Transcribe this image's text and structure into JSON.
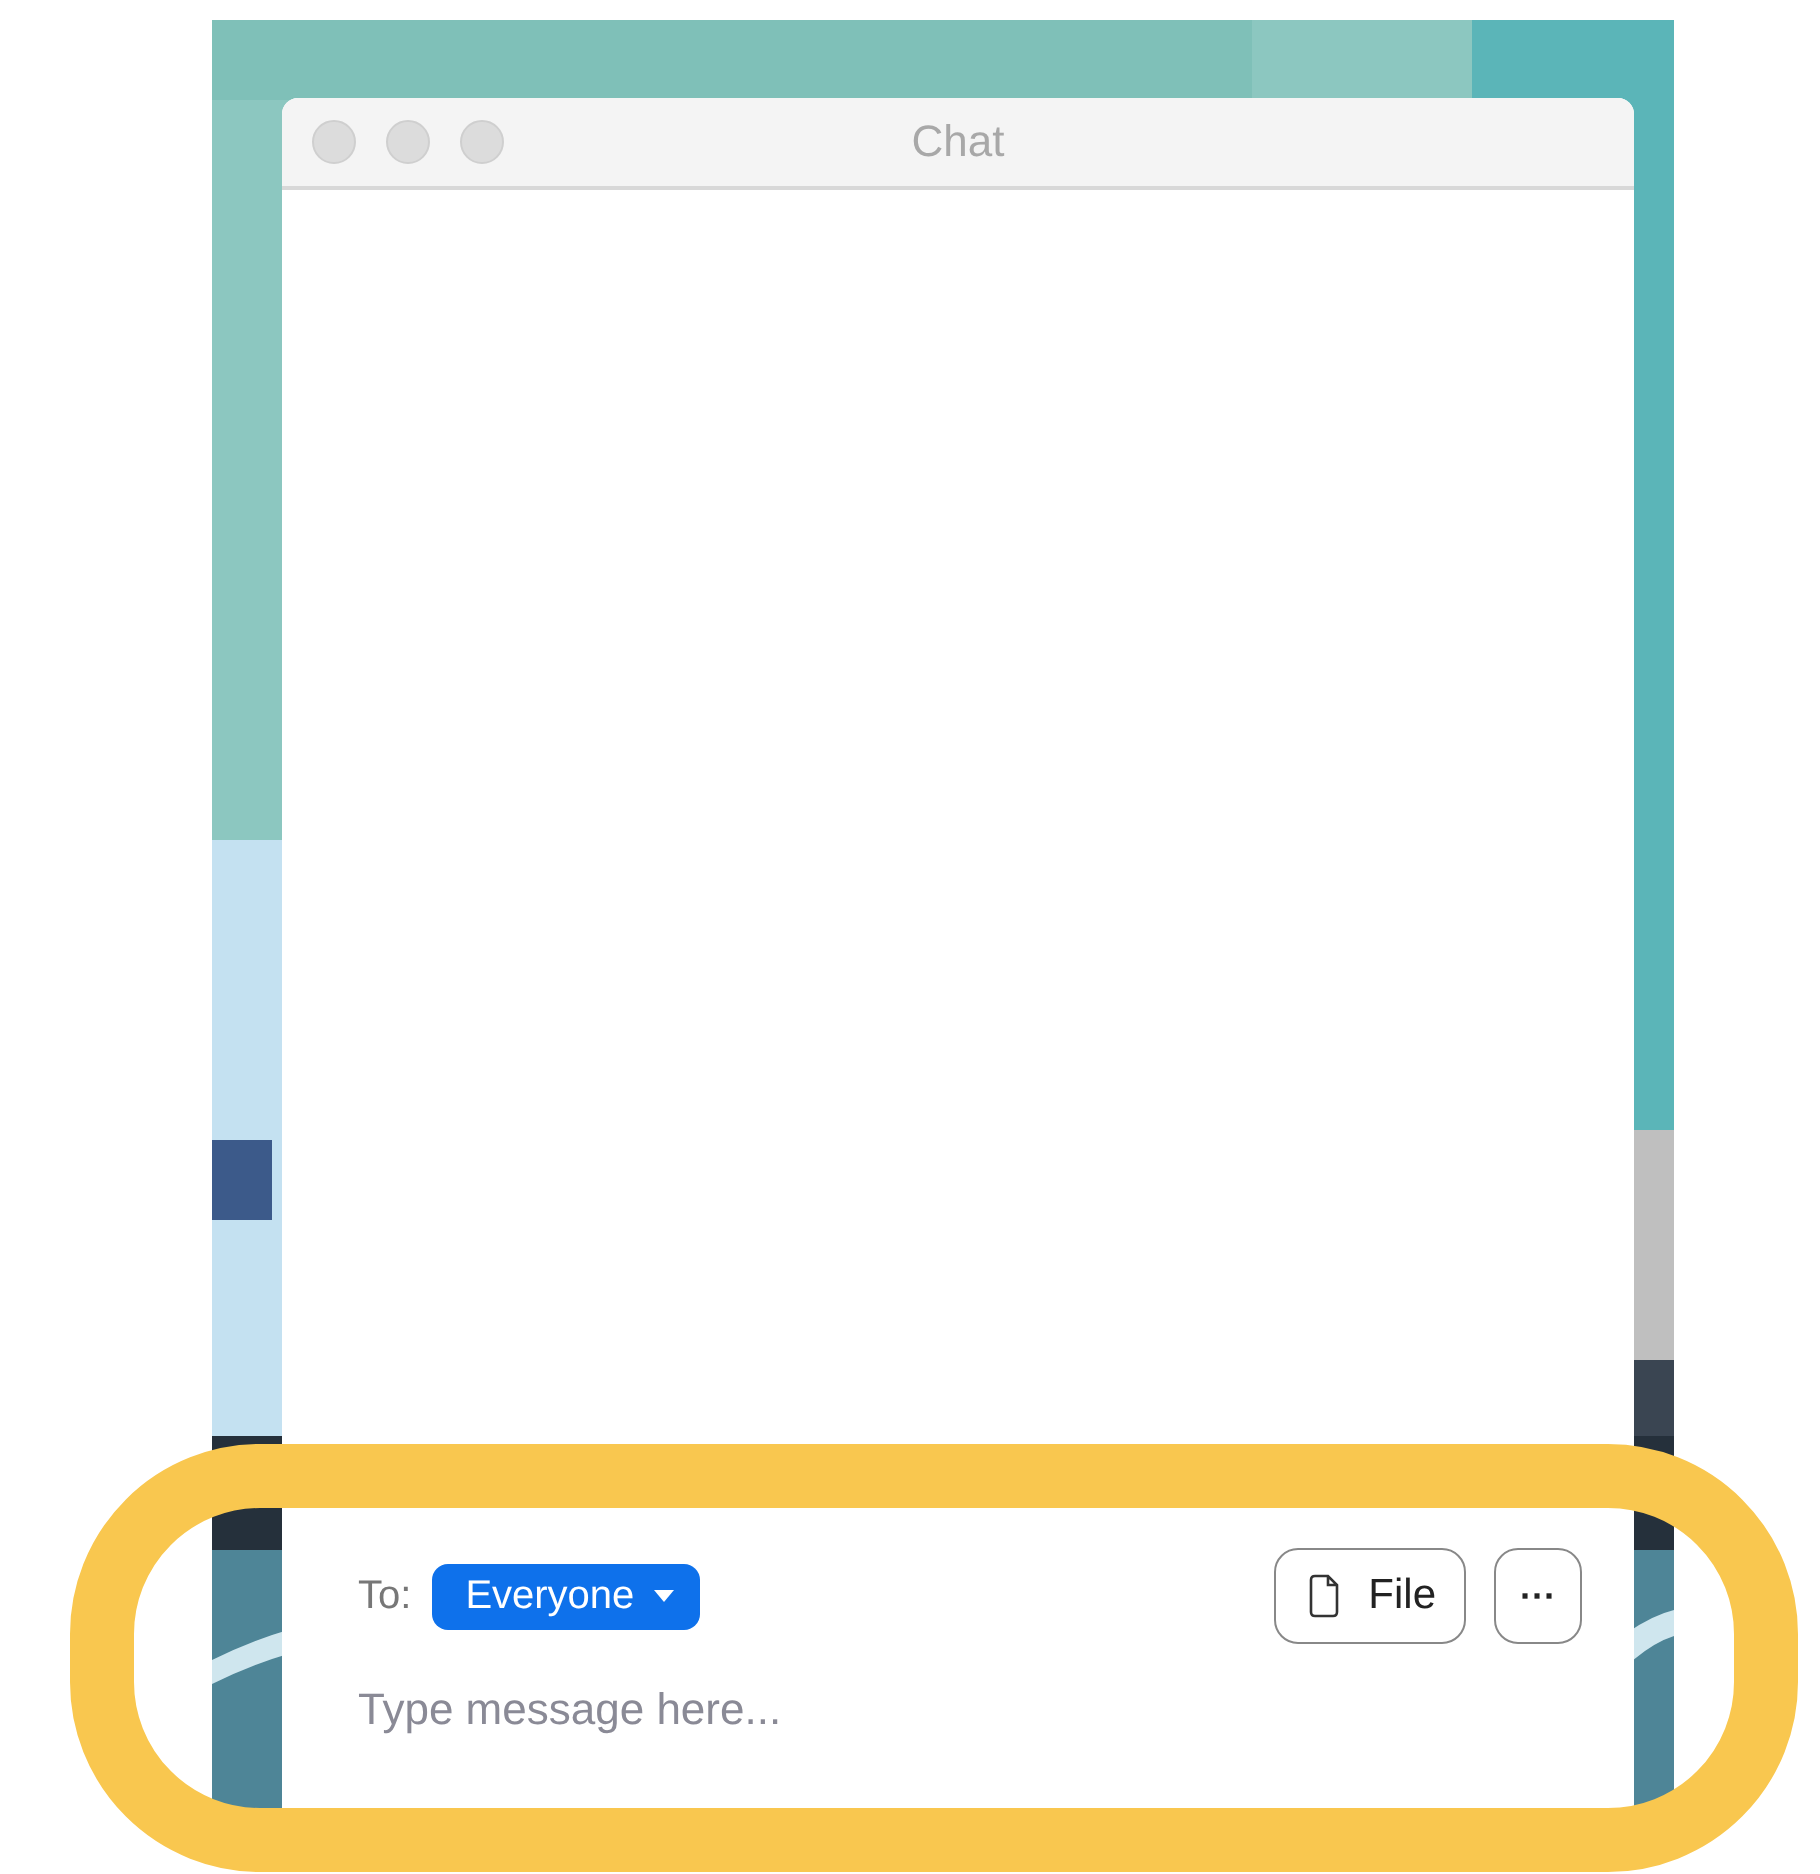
{
  "window": {
    "title": "Chat"
  },
  "composer": {
    "to_label": "To:",
    "recipient": "Everyone",
    "file_button": "File",
    "more_button": "···",
    "message": {
      "placeholder": "Type message here..."
    }
  },
  "highlight": {
    "kind": "rounded-outline",
    "color": "#f9c74f"
  }
}
